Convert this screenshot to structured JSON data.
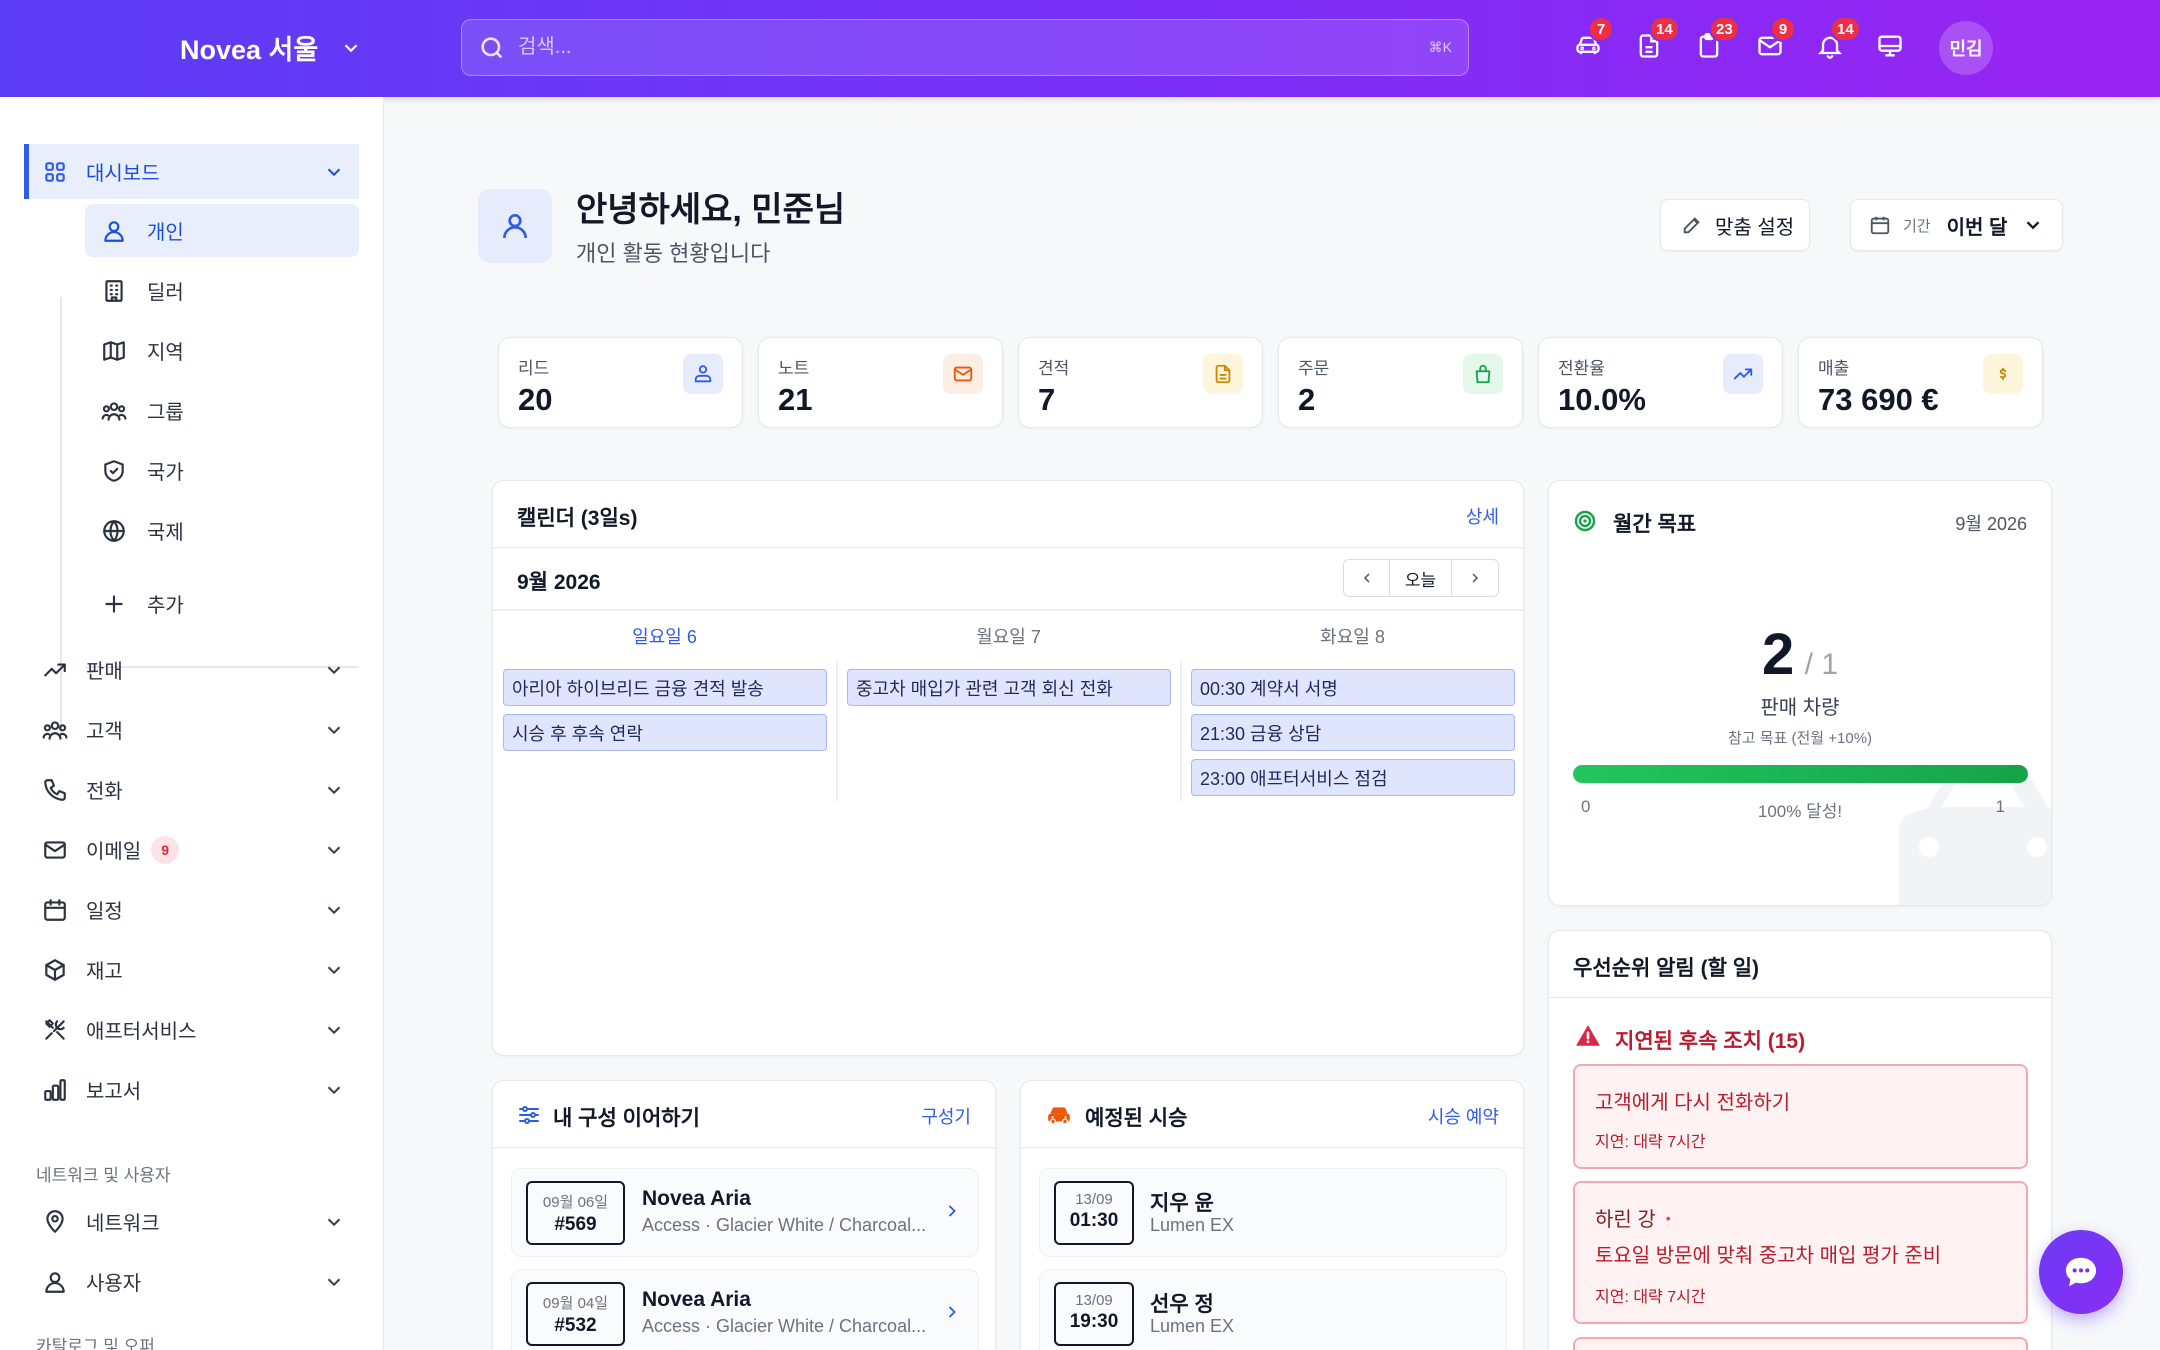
{
  "topbar": {
    "brand": "Novea 서울",
    "search_placeholder": "검색...",
    "search_shortcut": "⌘K",
    "icons": [
      {
        "name": "car-icon",
        "badge": "7"
      },
      {
        "name": "document-icon",
        "badge": "14"
      },
      {
        "name": "clipboard-icon",
        "badge": "23"
      },
      {
        "name": "mail-icon",
        "badge": "9"
      },
      {
        "name": "bell-icon",
        "badge": "14"
      },
      {
        "name": "monitor-icon",
        "badge": ""
      }
    ],
    "avatar": "민김"
  },
  "sidebar": {
    "dashboard": "대시보드",
    "sub": {
      "personal": "개인",
      "dealer": "딜러",
      "region": "지역",
      "group": "그룹",
      "country": "국가",
      "international": "국제",
      "add": "추가"
    },
    "items": {
      "sales": "판매",
      "customers": "고객",
      "calls": "전화",
      "email": "이메일",
      "email_badge": "9",
      "schedule": "일정",
      "inventory": "재고",
      "aftersales": "애프터서비스",
      "reports": "보고서"
    },
    "heading_network": "네트워크 및 사용자",
    "network": "네트워크",
    "users": "사용자",
    "heading_catalog": "카탈로그 및 오퍼"
  },
  "header": {
    "title": "안녕하세요, 민준님",
    "subtitle": "개인 활동 현황입니다",
    "customize_label": "맞춤 설정",
    "period_label": "기간",
    "period_value": "이번 달"
  },
  "stats": [
    {
      "label": "리드",
      "value": "20"
    },
    {
      "label": "노트",
      "value": "21"
    },
    {
      "label": "견적",
      "value": "7"
    },
    {
      "label": "주문",
      "value": "2"
    },
    {
      "label": "전환율",
      "value": "10.0%"
    },
    {
      "label": "매출",
      "value": "73 690 €"
    }
  ],
  "calendar": {
    "title": "캘린더 (3일s)",
    "detail_link": "상세",
    "month": "9월 2026",
    "today_label": "오늘",
    "days": [
      "일요일 6",
      "월요일 7",
      "화요일 8"
    ],
    "events": {
      "sun": [
        "아리아 하이브리드 금융 견적 발송",
        "시승 후 후속 연락"
      ],
      "mon": [
        "중고차 매입가 관련 고객 회신 전화"
      ],
      "tue": [
        "00:30 계약서 서명",
        "21:30 금융 상담",
        "23:00 애프터서비스 점검"
      ]
    }
  },
  "goal": {
    "title": "월간 목표",
    "month": "9월 2026",
    "value": "2",
    "target": "/ 1",
    "label": "판매 차량",
    "reference": "참고 목표 (전월 +10%)",
    "progress": 1.0,
    "min": "0",
    "progress_text": "100% 달성!",
    "max": "1"
  },
  "configs": {
    "title": "내 구성 이어하기",
    "link": "구성기",
    "rows": [
      {
        "date": "09월 06일",
        "num": "#569",
        "model": "Novea Aria",
        "desc": "Access · Glacier White / Charcoal..."
      },
      {
        "date": "09월 04일",
        "num": "#532",
        "model": "Novea Aria",
        "desc": "Access · Glacier White / Charcoal..."
      }
    ]
  },
  "testdrives": {
    "title": "예정된 시승",
    "link": "시승 예약",
    "rows": [
      {
        "date": "13/09",
        "time": "01:30",
        "name": "지우 윤",
        "model": "Lumen EX"
      },
      {
        "date": "13/09",
        "time": "19:30",
        "name": "선우 정",
        "model": "Lumen EX"
      }
    ]
  },
  "alerts": {
    "title": "우선순위 알림 (할 일)",
    "section": "지연된 후속 조치 (15)",
    "items": [
      {
        "title": "고객에게 다시 전화하기",
        "delay": "지연: 대략 7시간"
      },
      {
        "who": "하린 강",
        "title": "토요일 방문에 맞춰 중고차 매입 평가 준비",
        "delay": "지연: 대략 7시간"
      }
    ]
  },
  "colors": {
    "accent": "#2f5bea",
    "brand_start": "#5b3df5",
    "brand_end": "#9a24f2",
    "danger": "#dc2643",
    "success": "#16a34a"
  }
}
